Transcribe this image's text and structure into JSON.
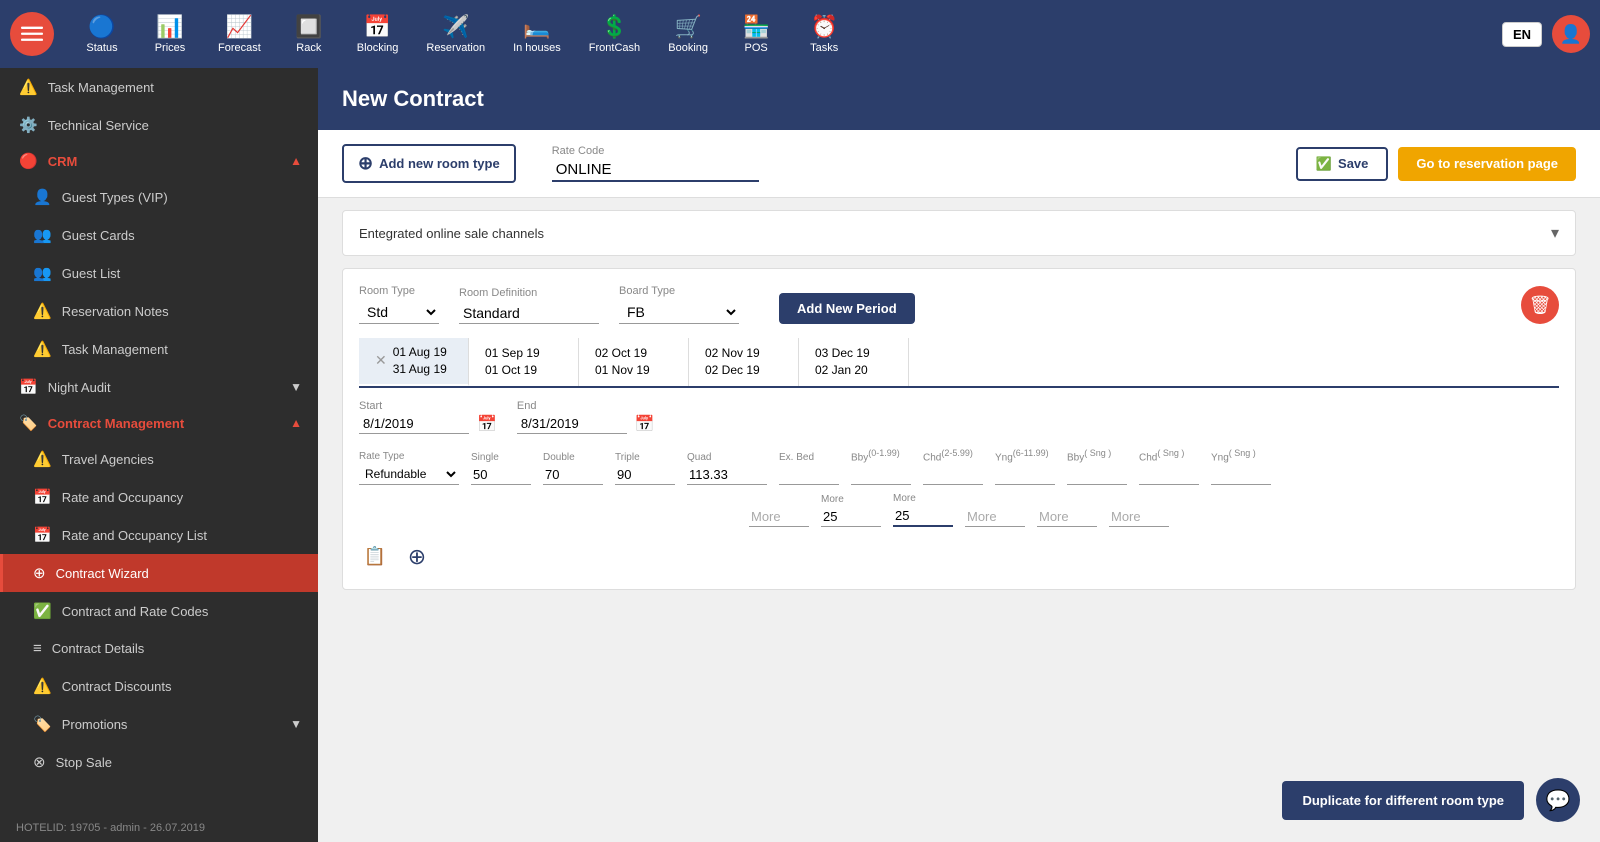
{
  "topNav": {
    "items": [
      {
        "id": "status",
        "label": "Status",
        "icon": "🔵"
      },
      {
        "id": "prices",
        "label": "Prices",
        "icon": "📊"
      },
      {
        "id": "forecast",
        "label": "Forecast",
        "icon": "📈"
      },
      {
        "id": "rack",
        "label": "Rack",
        "icon": "🔲"
      },
      {
        "id": "blocking",
        "label": "Blocking",
        "icon": "📅"
      },
      {
        "id": "reservation",
        "label": "Reservation",
        "icon": "✈️"
      },
      {
        "id": "inhouses",
        "label": "In houses",
        "icon": "🛏️"
      },
      {
        "id": "frontcash",
        "label": "FrontCash",
        "icon": "💲"
      },
      {
        "id": "booking",
        "label": "Booking",
        "icon": "🛒"
      },
      {
        "id": "pos",
        "label": "POS",
        "icon": "🏪"
      },
      {
        "id": "tasks",
        "label": "Tasks",
        "icon": "⏰"
      }
    ],
    "lang": "EN"
  },
  "sidebar": {
    "items": [
      {
        "id": "task-management",
        "label": "Task Management",
        "icon": "⚠️",
        "indent": 0
      },
      {
        "id": "technical-service",
        "label": "Technical Service",
        "icon": "⚙️",
        "indent": 0
      },
      {
        "id": "crm",
        "label": "CRM",
        "icon": "🔴",
        "isSection": true,
        "hasArrow": true,
        "arrowUp": true
      },
      {
        "id": "guest-types",
        "label": "Guest Types (VIP)",
        "icon": "👤",
        "indent": 1
      },
      {
        "id": "guest-cards",
        "label": "Guest Cards",
        "icon": "👥",
        "indent": 1
      },
      {
        "id": "guest-list",
        "label": "Guest List",
        "icon": "👥",
        "indent": 1
      },
      {
        "id": "reservation-notes",
        "label": "Reservation Notes",
        "icon": "⚠️",
        "indent": 1
      },
      {
        "id": "task-management2",
        "label": "Task Management",
        "icon": "⚠️",
        "indent": 1
      },
      {
        "id": "night-audit",
        "label": "Night Audit",
        "icon": "📅",
        "isSection": false,
        "hasArrow": true,
        "arrowDown": true
      },
      {
        "id": "contract-management",
        "label": "Contract Management",
        "icon": "🏷️",
        "isSection": true,
        "hasArrow": true,
        "arrowUp": true
      },
      {
        "id": "travel-agencies",
        "label": "Travel Agencies",
        "icon": "⚠️",
        "indent": 1
      },
      {
        "id": "rate-occupancy",
        "label": "Rate and Occupancy",
        "icon": "📅",
        "indent": 1
      },
      {
        "id": "rate-occupancy-list",
        "label": "Rate and Occupancy List",
        "icon": "📅",
        "indent": 1
      },
      {
        "id": "contract-wizard",
        "label": "Contract Wizard",
        "icon": "⊕",
        "indent": 1,
        "isActive": true
      },
      {
        "id": "contract-rate-codes",
        "label": "Contract and Rate Codes",
        "icon": "✅",
        "indent": 1
      },
      {
        "id": "contract-details",
        "label": "Contract Details",
        "icon": "≡",
        "indent": 1
      },
      {
        "id": "contract-discounts",
        "label": "Contract Discounts",
        "icon": "⚠️",
        "indent": 1
      },
      {
        "id": "promotions",
        "label": "Promotions",
        "icon": "🏷️",
        "indent": 1,
        "hasArrow": true,
        "arrowDown": true
      },
      {
        "id": "stop-sale",
        "label": "Stop Sale",
        "icon": "⊗",
        "indent": 1
      }
    ],
    "footer": "HOTELID: 19705 - admin - 26.07.2019"
  },
  "page": {
    "title": "New Contract",
    "addRoomTypeBtn": "Add new room type",
    "rateCodeLabel": "Rate Code",
    "rateCodeValue": "ONLINE",
    "saveBtn": "Save",
    "gotoBtn": "Go to reservation page",
    "dropdown": {
      "text": "Entegrated online sale channels",
      "arrow": "▾"
    },
    "roomCard": {
      "roomTypeLabel": "Room Type",
      "roomTypeValue": "Std",
      "roomDefinitionLabel": "Room Definition",
      "roomDefinitionValue": "Standard",
      "boardTypeLabel": "Board Type",
      "boardTypeValue": "FB",
      "addPeriodBtn": "Add New Period",
      "periods": [
        {
          "id": 1,
          "from": "01 Aug 19",
          "to": "31 Aug 19",
          "active": true,
          "showDelete": true
        },
        {
          "id": 2,
          "from": "01 Sep 19",
          "to": "01 Oct 19",
          "active": false
        },
        {
          "id": 3,
          "from": "02 Oct 19",
          "to": "01 Nov 19",
          "active": false
        },
        {
          "id": 4,
          "from": "02 Nov 19",
          "to": "02 Dec 19",
          "active": false
        },
        {
          "id": 5,
          "from": "03 Dec 19",
          "to": "02 Jan 20",
          "active": false
        }
      ],
      "startLabel": "Start",
      "startValue": "8/1/2019",
      "endLabel": "End",
      "endValue": "8/31/2019",
      "rateTypeLabel": "Rate Type",
      "rateTypeValue": "Refundable",
      "rates": [
        {
          "label": "Single",
          "sublabel": "",
          "value": "50"
        },
        {
          "label": "Double",
          "sublabel": "",
          "value": "70"
        },
        {
          "label": "Triple",
          "sublabel": "",
          "value": "90"
        },
        {
          "label": "Quad",
          "sublabel": "",
          "value": "113.33"
        },
        {
          "label": "Ex. Bed",
          "sublabel": "",
          "value": ""
        },
        {
          "label": "Bby",
          "sublabel": "(0-1.99)",
          "value": ""
        },
        {
          "label": "Chd",
          "sublabel": "(2-5.99)",
          "value": ""
        },
        {
          "label": "Yng",
          "sublabel": "(6-11.99)",
          "value": ""
        },
        {
          "label": "Bby",
          "sublabel": "( Sng )",
          "value": ""
        },
        {
          "label": "Chd",
          "sublabel": "( Sng )",
          "value": ""
        },
        {
          "label": "Yng",
          "sublabel": "( Sng )",
          "value": ""
        }
      ],
      "rates2": [
        {
          "label": "",
          "value": "More",
          "isText": true
        },
        {
          "label": "More",
          "value": "25"
        },
        {
          "label": "More",
          "value": "25"
        },
        {
          "label": "",
          "value": "More",
          "isText": true
        },
        {
          "label": "",
          "value": "More",
          "isText": true
        },
        {
          "label": "",
          "value": "More",
          "isText": true
        }
      ]
    },
    "duplicateBtn": "Duplicate for different room type"
  }
}
